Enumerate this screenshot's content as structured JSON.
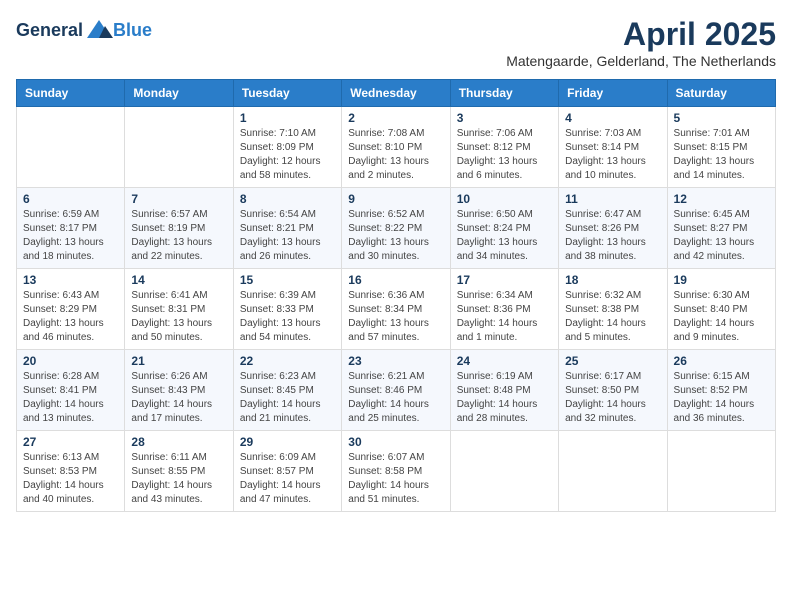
{
  "logo": {
    "general": "General",
    "blue": "Blue"
  },
  "title": "April 2025",
  "location": "Matengaarde, Gelderland, The Netherlands",
  "weekdays": [
    "Sunday",
    "Monday",
    "Tuesday",
    "Wednesday",
    "Thursday",
    "Friday",
    "Saturday"
  ],
  "weeks": [
    [
      {
        "day": "",
        "info": ""
      },
      {
        "day": "",
        "info": ""
      },
      {
        "day": "1",
        "info": "Sunrise: 7:10 AM\nSunset: 8:09 PM\nDaylight: 12 hours and 58 minutes."
      },
      {
        "day": "2",
        "info": "Sunrise: 7:08 AM\nSunset: 8:10 PM\nDaylight: 13 hours and 2 minutes."
      },
      {
        "day": "3",
        "info": "Sunrise: 7:06 AM\nSunset: 8:12 PM\nDaylight: 13 hours and 6 minutes."
      },
      {
        "day": "4",
        "info": "Sunrise: 7:03 AM\nSunset: 8:14 PM\nDaylight: 13 hours and 10 minutes."
      },
      {
        "day": "5",
        "info": "Sunrise: 7:01 AM\nSunset: 8:15 PM\nDaylight: 13 hours and 14 minutes."
      }
    ],
    [
      {
        "day": "6",
        "info": "Sunrise: 6:59 AM\nSunset: 8:17 PM\nDaylight: 13 hours and 18 minutes."
      },
      {
        "day": "7",
        "info": "Sunrise: 6:57 AM\nSunset: 8:19 PM\nDaylight: 13 hours and 22 minutes."
      },
      {
        "day": "8",
        "info": "Sunrise: 6:54 AM\nSunset: 8:21 PM\nDaylight: 13 hours and 26 minutes."
      },
      {
        "day": "9",
        "info": "Sunrise: 6:52 AM\nSunset: 8:22 PM\nDaylight: 13 hours and 30 minutes."
      },
      {
        "day": "10",
        "info": "Sunrise: 6:50 AM\nSunset: 8:24 PM\nDaylight: 13 hours and 34 minutes."
      },
      {
        "day": "11",
        "info": "Sunrise: 6:47 AM\nSunset: 8:26 PM\nDaylight: 13 hours and 38 minutes."
      },
      {
        "day": "12",
        "info": "Sunrise: 6:45 AM\nSunset: 8:27 PM\nDaylight: 13 hours and 42 minutes."
      }
    ],
    [
      {
        "day": "13",
        "info": "Sunrise: 6:43 AM\nSunset: 8:29 PM\nDaylight: 13 hours and 46 minutes."
      },
      {
        "day": "14",
        "info": "Sunrise: 6:41 AM\nSunset: 8:31 PM\nDaylight: 13 hours and 50 minutes."
      },
      {
        "day": "15",
        "info": "Sunrise: 6:39 AM\nSunset: 8:33 PM\nDaylight: 13 hours and 54 minutes."
      },
      {
        "day": "16",
        "info": "Sunrise: 6:36 AM\nSunset: 8:34 PM\nDaylight: 13 hours and 57 minutes."
      },
      {
        "day": "17",
        "info": "Sunrise: 6:34 AM\nSunset: 8:36 PM\nDaylight: 14 hours and 1 minute."
      },
      {
        "day": "18",
        "info": "Sunrise: 6:32 AM\nSunset: 8:38 PM\nDaylight: 14 hours and 5 minutes."
      },
      {
        "day": "19",
        "info": "Sunrise: 6:30 AM\nSunset: 8:40 PM\nDaylight: 14 hours and 9 minutes."
      }
    ],
    [
      {
        "day": "20",
        "info": "Sunrise: 6:28 AM\nSunset: 8:41 PM\nDaylight: 14 hours and 13 minutes."
      },
      {
        "day": "21",
        "info": "Sunrise: 6:26 AM\nSunset: 8:43 PM\nDaylight: 14 hours and 17 minutes."
      },
      {
        "day": "22",
        "info": "Sunrise: 6:23 AM\nSunset: 8:45 PM\nDaylight: 14 hours and 21 minutes."
      },
      {
        "day": "23",
        "info": "Sunrise: 6:21 AM\nSunset: 8:46 PM\nDaylight: 14 hours and 25 minutes."
      },
      {
        "day": "24",
        "info": "Sunrise: 6:19 AM\nSunset: 8:48 PM\nDaylight: 14 hours and 28 minutes."
      },
      {
        "day": "25",
        "info": "Sunrise: 6:17 AM\nSunset: 8:50 PM\nDaylight: 14 hours and 32 minutes."
      },
      {
        "day": "26",
        "info": "Sunrise: 6:15 AM\nSunset: 8:52 PM\nDaylight: 14 hours and 36 minutes."
      }
    ],
    [
      {
        "day": "27",
        "info": "Sunrise: 6:13 AM\nSunset: 8:53 PM\nDaylight: 14 hours and 40 minutes."
      },
      {
        "day": "28",
        "info": "Sunrise: 6:11 AM\nSunset: 8:55 PM\nDaylight: 14 hours and 43 minutes."
      },
      {
        "day": "29",
        "info": "Sunrise: 6:09 AM\nSunset: 8:57 PM\nDaylight: 14 hours and 47 minutes."
      },
      {
        "day": "30",
        "info": "Sunrise: 6:07 AM\nSunset: 8:58 PM\nDaylight: 14 hours and 51 minutes."
      },
      {
        "day": "",
        "info": ""
      },
      {
        "day": "",
        "info": ""
      },
      {
        "day": "",
        "info": ""
      }
    ]
  ]
}
